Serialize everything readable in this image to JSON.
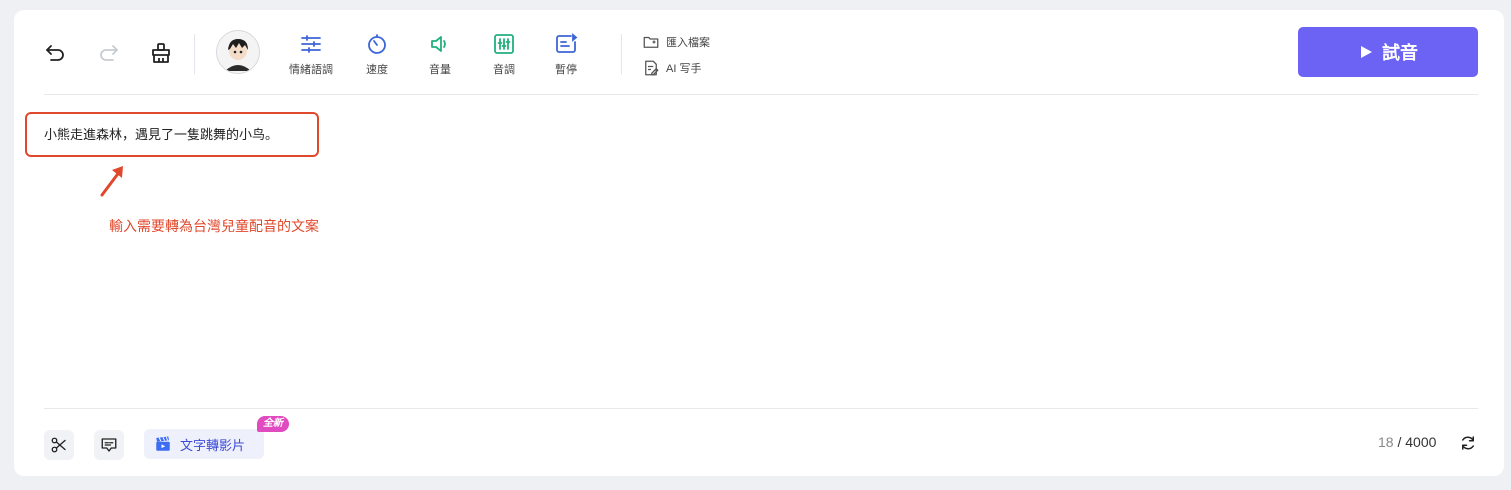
{
  "toolbar": {
    "undo_icon": "undo-icon",
    "redo_icon": "redo-icon",
    "clear_icon": "broom-icon",
    "tools": [
      {
        "label": "情緒語調",
        "icon": "sliders-icon",
        "color": "#3c66d8"
      },
      {
        "label": "速度",
        "icon": "timer-icon",
        "color": "#3c66d8"
      },
      {
        "label": "音量",
        "icon": "speaker-icon",
        "color": "#22b07d"
      },
      {
        "label": "音調",
        "icon": "equalizer-icon",
        "color": "#22b07d"
      },
      {
        "label": "暫停",
        "icon": "pause-text-icon",
        "color": "#3c66d8"
      }
    ],
    "import_file": "匯入檔案",
    "ai_writer": "AI 写手",
    "try_button": "試音"
  },
  "editor": {
    "text": "小熊走進森林，遇見了一隻跳舞的小鸟。"
  },
  "annotation": {
    "text": "輸入需要轉為台灣兒童配音的文案",
    "color": "#e0482b"
  },
  "footer": {
    "text_to_video": "文字轉影片",
    "new_badge": "全新",
    "char_count": "18",
    "char_separator": " / ",
    "char_limit": "4000"
  },
  "colors": {
    "accent": "#6c63f5",
    "annotation": "#e0482b",
    "badge": "#e04bc0"
  }
}
